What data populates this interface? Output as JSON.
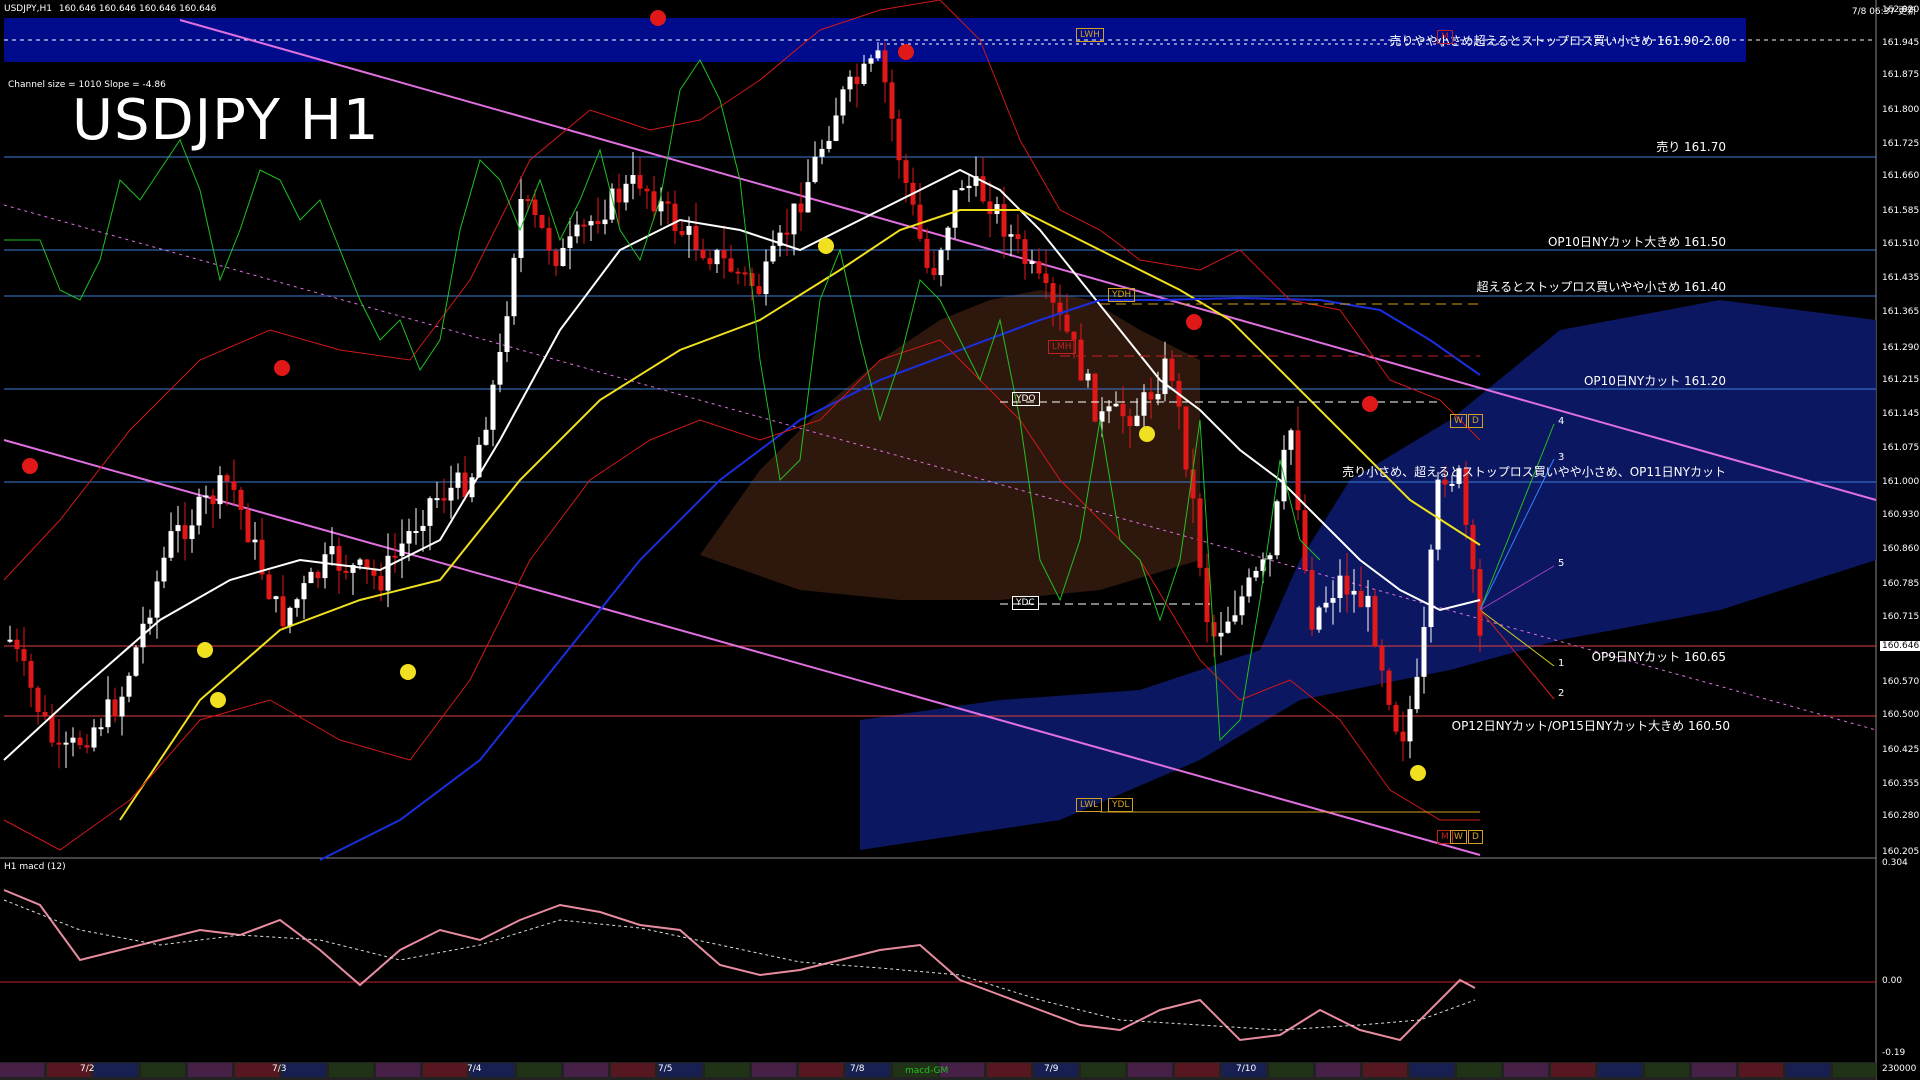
{
  "header": {
    "symbol_info": "USDJPY,H1",
    "ohlc": "160.646 160.646 160.646 160.646",
    "datetime": "7/8 06:37 更新",
    "channel_info": "Channel size = 1010 Slope = -4.86",
    "big_title": "USDJPY H1"
  },
  "price_scale": [
    "162.020",
    "161.945",
    "161.875",
    "161.800",
    "161.725",
    "161.660",
    "161.585",
    "161.510",
    "161.435",
    "161.365",
    "161.290",
    "161.215",
    "161.145",
    "161.075",
    "161.000",
    "160.930",
    "160.860",
    "160.785",
    "160.715",
    "160.646",
    "160.570",
    "160.500",
    "160.425",
    "160.355",
    "160.280",
    "160.205"
  ],
  "current_price": "160.646",
  "levels": [
    {
      "label": "売りやや小さめ超えるとストップロス買い小さめ 161.90-2.00",
      "color": "#ffffff"
    },
    {
      "label": "売り 161.70",
      "color": "#3b7dd8"
    },
    {
      "label": "OP10日NYカット大きめ 161.50",
      "color": "#3b7dd8"
    },
    {
      "label": "超えるとストップロス買いやや小さめ 161.40",
      "color": "#3b7dd8"
    },
    {
      "label": "OP10日NYカット 161.20",
      "color": "#3b7dd8"
    },
    {
      "label": "売り小さめ、超えるとストップロス買いやや小さめ、OP11日NYカット",
      "color": "#3b7dd8"
    },
    {
      "label": "OP9日NYカット 160.65",
      "color": "#e04040"
    },
    {
      "label": "OP12日NYカット/OP15日NYカット大きめ 160.50",
      "color": "#e04040"
    }
  ],
  "markers": {
    "lwh": "LWH",
    "ydh": "YDH",
    "lwl": "LWL",
    "ydl": "YDL",
    "ydo": "YDO",
    "ydc": "YDC",
    "lmh": "LMH",
    "m": "M",
    "w": "W",
    "d": "D"
  },
  "fan_labels": [
    "4",
    "3",
    "5",
    "1",
    "2"
  ],
  "macd": {
    "title": "H1 macd (12)",
    "scale_top": "0.304",
    "scale_zero": "0.00",
    "scale_bottom": "-0.19",
    "scale_min": "230000"
  },
  "dates": [
    "7/2",
    "7/3",
    "7/4",
    "7/5",
    "7/8",
    "7/9",
    "7/10"
  ],
  "date_badge": "macd-GM",
  "colors": {
    "band_blue": "#000c8c",
    "level_blue": "#3b7dd8",
    "level_red": "#c0202a",
    "white_ma": "#ffffff",
    "yellow_ma": "#f0e020",
    "blue_ma": "#1a2ee0",
    "green_osc": "#20c020",
    "red_band": "#d01818",
    "channel_pink": "#e070e0",
    "macd_line": "#e88ca0",
    "macd_signal": "#dddddd"
  }
}
